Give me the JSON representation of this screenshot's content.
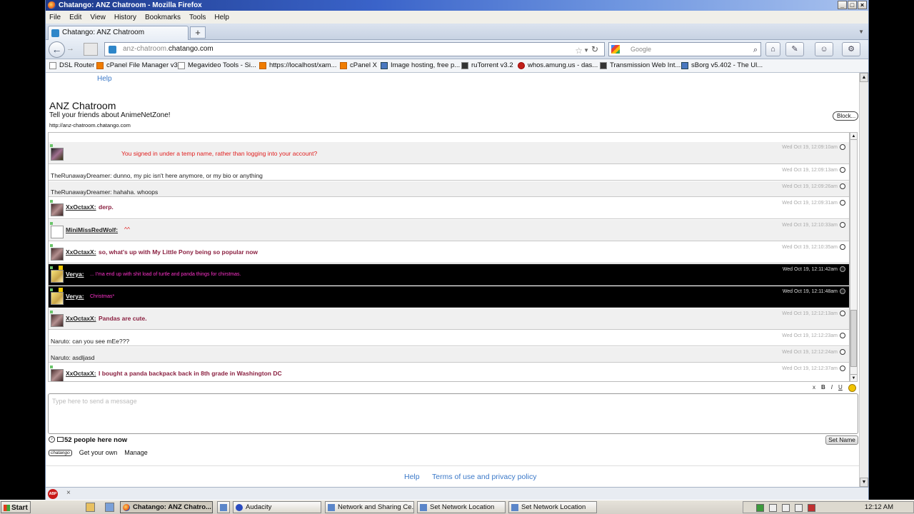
{
  "window": {
    "title": "Chatango: ANZ Chatroom - Mozilla Firefox"
  },
  "menu": [
    "File",
    "Edit",
    "View",
    "History",
    "Bookmarks",
    "Tools",
    "Help"
  ],
  "tab": {
    "title": "Chatango: ANZ Chatroom",
    "new_tab": "+"
  },
  "url": {
    "prefix": "anz-chatroom.",
    "domain": "chatango.com"
  },
  "search": {
    "placeholder": "Google"
  },
  "bookmarks": [
    "DSL Router",
    "cPanel File Manager v3",
    "Megavideo Tools - Si...",
    "https://localhost/xam...",
    "cPanel X",
    "Image hosting, free p...",
    "ruTorrent v3.2",
    "whos.amung.us - das...",
    "Transmission Web Int...",
    "sBorg v5.402 - The Ul..."
  ],
  "page": {
    "top_help": "Help",
    "room_title": "ANZ Chatroom",
    "tagline": "Tell your friends about AnimeNetZone!",
    "room_url": "http://anz-chatroom.chatango.com",
    "block_label": "Block..."
  },
  "messages": [
    {
      "name": "",
      "text": "You signed in under a temp name, rather than logging into your account?",
      "time": "Wed Oct 19, 12:09:10am"
    },
    {
      "name": "",
      "text": "TheRunawayDreamer: dunno, my pic isn't here anymore, or my bio or anything",
      "time": "Wed Oct 19, 12:09:13am"
    },
    {
      "name": "",
      "text": "TheRunawayDreamer: hahaha. whoops",
      "time": "Wed Oct 19, 12:09:26am"
    },
    {
      "name": "XxOctaxX:",
      "text": "derp.",
      "time": "Wed Oct 19, 12:09:31am"
    },
    {
      "name": "MiniMissRedWolf:",
      "text": "^^",
      "time": "Wed Oct 19, 12:10:33am"
    },
    {
      "name": "XxOctaxX:",
      "text": "so, what's up with My Little Pony being so popular now",
      "time": "Wed Oct 19, 12:10:35am"
    },
    {
      "name": "Verya:",
      "text": "... I'ma end up with shit load of turtle and panda things for chirstmas.",
      "time": "Wed Oct 19, 12:11:42am"
    },
    {
      "name": "Verya:",
      "text": "Christmas*",
      "time": "Wed Oct 19, 12:11:48am"
    },
    {
      "name": "XxOctaxX:",
      "text": "Pandas are cute.",
      "time": "Wed Oct 19, 12:12:13am"
    },
    {
      "name": "",
      "text": "Naruto: can you see mEe???",
      "time": "Wed Oct 19, 12:12:23am"
    },
    {
      "name": "",
      "text": "Naruto: asdljasd",
      "time": "Wed Oct 19, 12:12:24am"
    },
    {
      "name": "XxOctaxX:",
      "text": "I bought a panda backpack back in 8th grade in Washington DC",
      "time": "Wed Oct 19, 12:12:37am"
    }
  ],
  "format_bar": [
    "x",
    "B",
    "I",
    "U"
  ],
  "input": {
    "placeholder": "Type here to send a message"
  },
  "people_count": "52 people here now",
  "set_name": "Set Name",
  "brand": {
    "logo": "chatango",
    "get_own": "Get your own",
    "manage": "Manage"
  },
  "footer": {
    "help": "Help",
    "terms": "Terms of use and privacy policy"
  },
  "taskbar": {
    "start": "Start",
    "tasks": [
      "Chatango: ANZ Chatro...",
      "Audacity",
      "Network and Sharing Ce...",
      "Set Network Location",
      "Set Network Location"
    ],
    "clock": "12:12 AM"
  }
}
